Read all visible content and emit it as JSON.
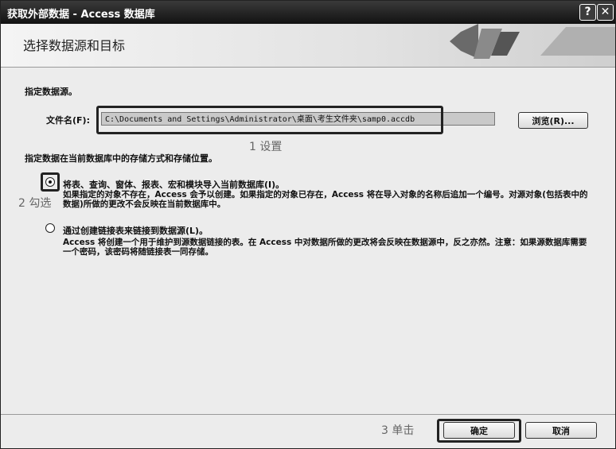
{
  "window": {
    "title": "获取外部数据 - Access 数据库",
    "help_glyph": "?",
    "close_glyph": "✕"
  },
  "banner": {
    "title": "选择数据源和目标"
  },
  "source": {
    "heading": "指定数据源。",
    "file_label": "文件名(F):",
    "file_path": "C:\\Documents and Settings\\Administrator\\桌面\\考生文件夹\\samp0.accdb",
    "browse_label": "浏览(R)..."
  },
  "storage": {
    "heading": "指定数据在当前数据库中的存储方式和存储位置。",
    "options": [
      {
        "label": "将表、查询、窗体、报表、宏和模块导入当前数据库(I)。",
        "description": "如果指定的对象不存在，Access 会予以创建。如果指定的对象已存在，Access 将在导入对象的名称后追加一个编号。对源对象(包括表中的数据)所做的更改不会反映在当前数据库中。",
        "selected": true
      },
      {
        "label": "通过创建链接表来链接到数据源(L)。",
        "description": "Access 将创建一个用于维护到源数据链接的表。在 Access 中对数据所做的更改将会反映在数据源中，反之亦然。注意：如果源数据库需要一个密码，该密码将随链接表一同存储。",
        "selected": false
      }
    ]
  },
  "annotations": {
    "step1": "1 设置",
    "step2": "2 勾选",
    "step3": "3 单击"
  },
  "footer": {
    "ok_label": "确定",
    "cancel_label": "取消"
  }
}
